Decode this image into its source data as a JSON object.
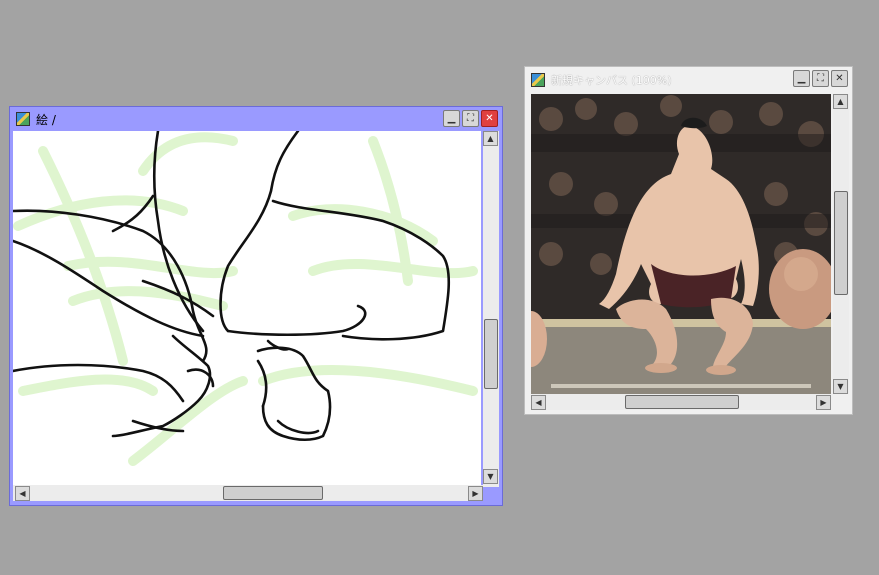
{
  "windows": {
    "sketch": {
      "title": "絵 /",
      "icon": "canvas-app-icon",
      "buttons": [
        "minimize-icon",
        "maximize-icon",
        "close-icon"
      ]
    },
    "reference": {
      "title": "新規キャンバス (100%)",
      "icon": "canvas-app-icon",
      "buttons": [
        "minimize-icon",
        "maximize-icon",
        "close-icon"
      ]
    }
  },
  "colors": {
    "desktop": "#a3a3a3",
    "active_titlebar": "#9a9aff",
    "close_button": "#e04040",
    "sketch_guides": "#dff5cf"
  },
  "glyphs": {
    "minimize": "▁",
    "maximize": "⛶",
    "close": "✕",
    "arrow_up": "▲",
    "arrow_down": "▼",
    "arrow_left": "◀",
    "arrow_right": "▶"
  }
}
